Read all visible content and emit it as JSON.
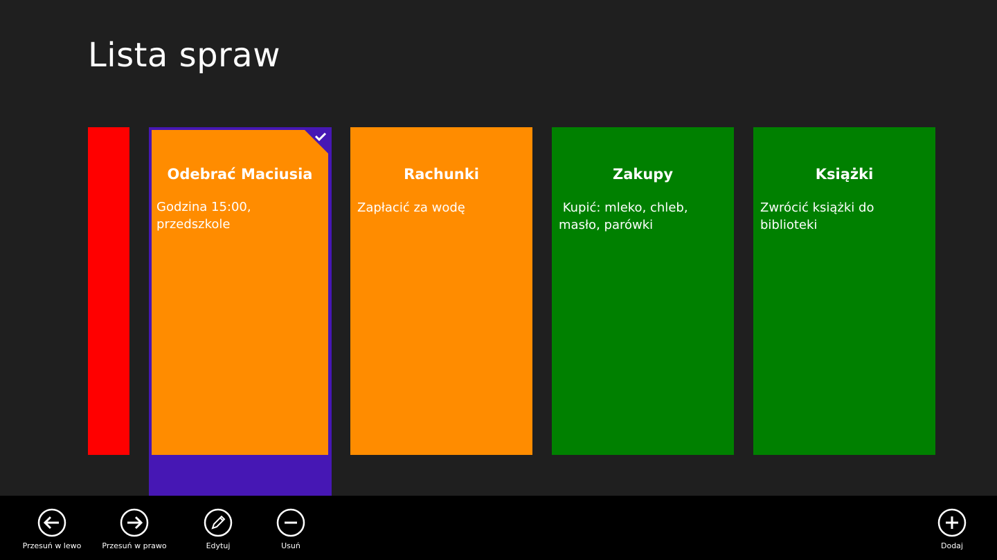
{
  "page": {
    "title": "Lista spraw"
  },
  "colors": {
    "background": "#1f1f1f",
    "app_bar": "#000000",
    "selection": "#4617b4",
    "red": "#ff0000",
    "orange": "#ff8c00",
    "green": "#008000"
  },
  "cards": [
    {
      "color": "#ff8c00",
      "title": "Odebrać Maciusia",
      "text": "Godzina 15:00, przedszkole",
      "selected": true
    },
    {
      "color": "#ff8c00",
      "title": "Rachunki",
      "text": "Zapłacić za wodę",
      "selected": false
    },
    {
      "color": "#008000",
      "title": "Zakupy",
      "text": " Kupić: mleko, chleb, masło, parówki",
      "selected": false
    },
    {
      "color": "#008000",
      "title": "Książki",
      "text": "Zwrócić książki do biblioteki",
      "selected": false
    }
  ],
  "app_bar": {
    "move_left": {
      "label": "Przesuń w lewo",
      "icon": "arrow-left-icon"
    },
    "move_right": {
      "label": "Przesuń w prawo",
      "icon": "arrow-right-icon"
    },
    "edit": {
      "label": "Edytuj",
      "icon": "pencil-icon"
    },
    "delete": {
      "label": "Usuń",
      "icon": "minus-icon"
    },
    "add": {
      "label": "Dodaj",
      "icon": "plus-icon"
    }
  }
}
